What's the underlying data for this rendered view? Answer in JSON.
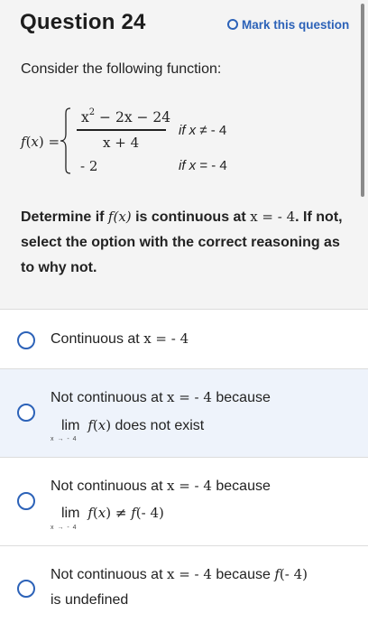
{
  "header": {
    "title": "Question 24",
    "mark_label": "Mark this question"
  },
  "question": {
    "intro": "Consider the following function:",
    "function": {
      "name": "f(x) =",
      "numerator": "x² − 2x − 24",
      "denominator": "x + 4",
      "condition1": "if x ≠ - 4",
      "value2": "- 2",
      "condition2": "if x = - 4"
    },
    "prompt_part1": "Determine if ",
    "prompt_fx": "f(x)",
    "prompt_part2": " is continuous at ",
    "prompt_x": "x = - 4",
    "prompt_part3": ". If not, select the option with the correct reasoning as to why not."
  },
  "options": [
    {
      "line1": "Continuous at x = - 4"
    },
    {
      "line1": "Not continuous at x = - 4 because",
      "lim": "lim",
      "lim_expr": "f(x) does not exist",
      "lim_sub": "x → - 4"
    },
    {
      "line1": "Not continuous at x = - 4 because",
      "lim": "lim",
      "lim_expr": "f(x) ≠ f(- 4)",
      "lim_sub": "x → - 4"
    },
    {
      "line1": "Not continuous at x = - 4 because f(- 4)",
      "line2": "is undefined"
    }
  ]
}
